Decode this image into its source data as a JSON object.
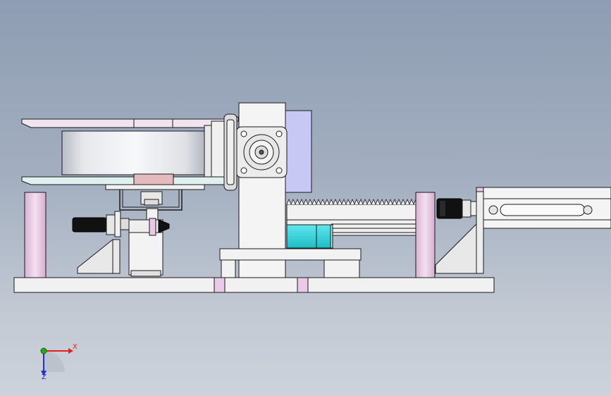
{
  "viewport": {
    "background_top": "#8e9db3",
    "background_bottom": "#cdd3db"
  },
  "triad": {
    "x_label": "X",
    "z_label": "Z",
    "x_color": "#dd2222",
    "y_color": "#22aa22",
    "z_color": "#2233cc"
  },
  "colors": {
    "edge": "#1a1a1a",
    "body_white": "#f2f2f2",
    "pink": "#e7c9e3",
    "lavender": "#c8c8f5",
    "cyan": "#2bd0d8",
    "rubber": "#111111",
    "steel": "#d6d6d6"
  }
}
